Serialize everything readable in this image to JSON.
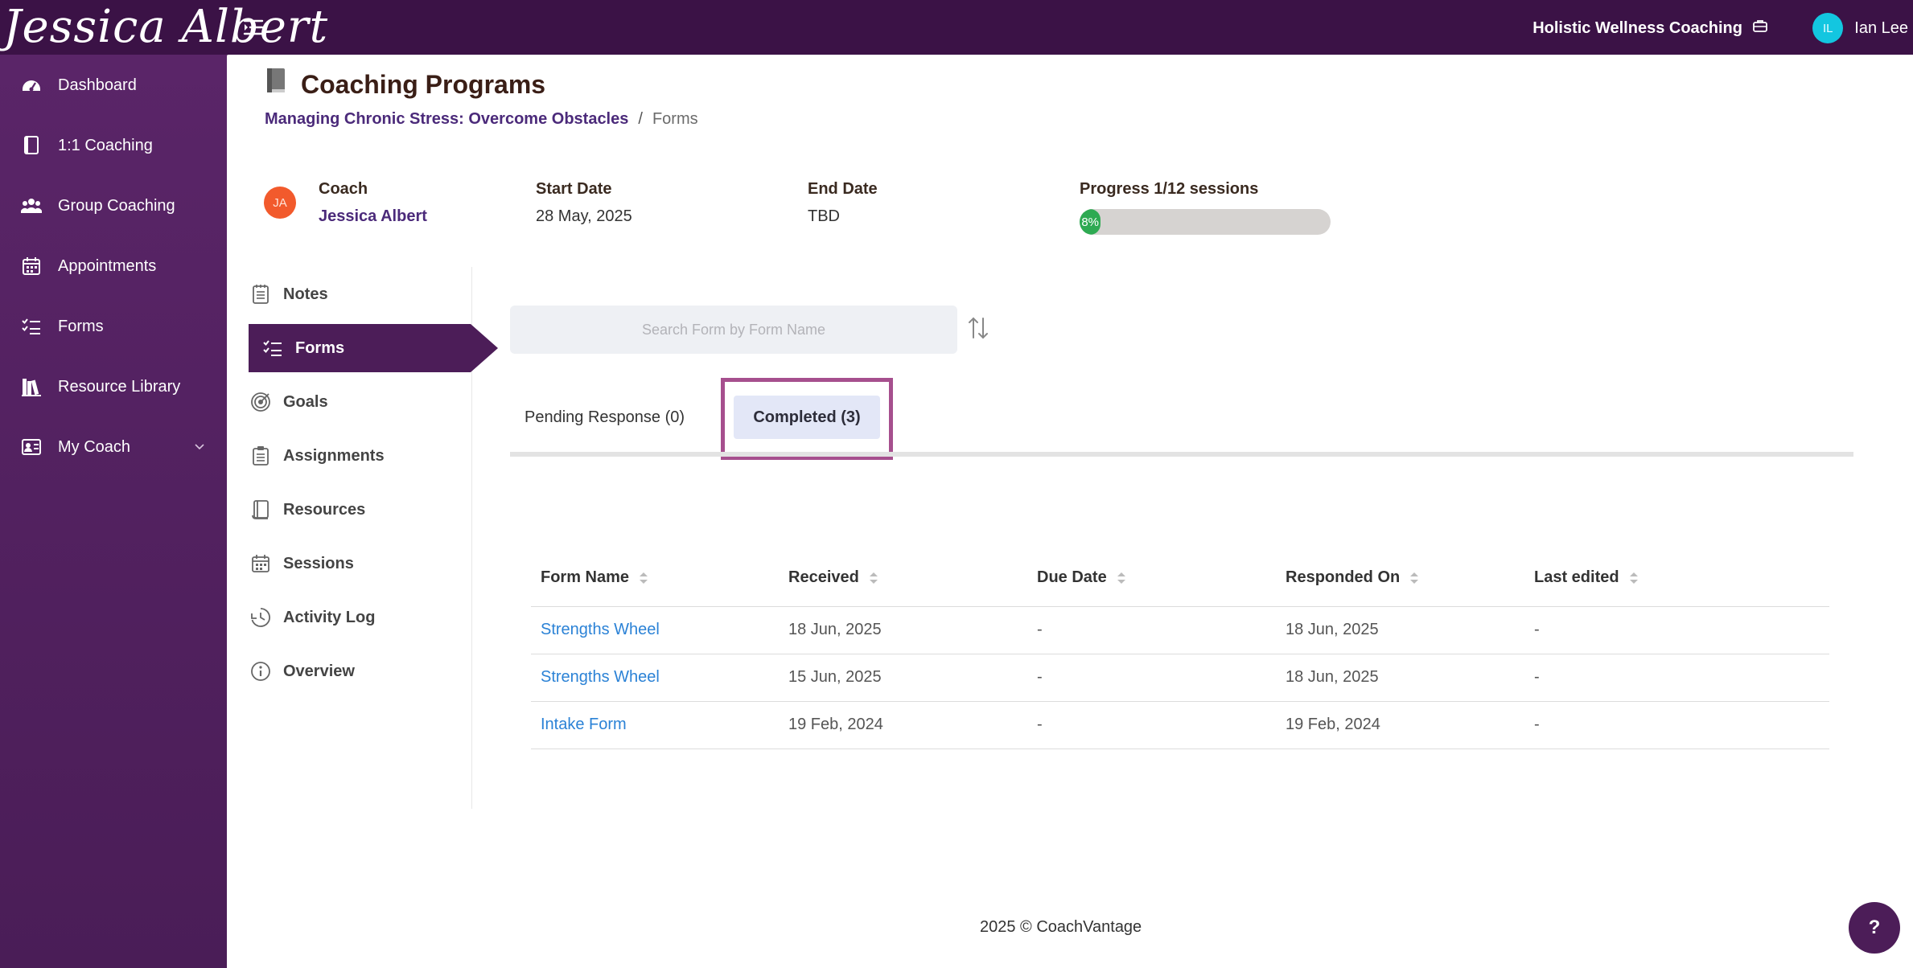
{
  "header": {
    "brand": "Jessica Albert",
    "organization": "Holistic Wellness Coaching",
    "user_initials": "IL",
    "user_name": "Ian Lee"
  },
  "sidebar": {
    "items": [
      {
        "label": "Dashboard",
        "icon": "dashboard-icon"
      },
      {
        "label": "1:1 Coaching",
        "icon": "book-icon"
      },
      {
        "label": "Group Coaching",
        "icon": "users-icon"
      },
      {
        "label": "Appointments",
        "icon": "calendar-icon"
      },
      {
        "label": "Forms",
        "icon": "checklist-icon"
      },
      {
        "label": "Resource Library",
        "icon": "library-icon"
      },
      {
        "label": "My Coach",
        "icon": "contact-card-icon"
      }
    ]
  },
  "page": {
    "title": "Coaching Programs",
    "breadcrumb": {
      "parent": "Managing Chronic Stress: Overcome Obstacles",
      "separator": "/",
      "current": "Forms"
    }
  },
  "program_info": {
    "coach_label": "Coach",
    "coach_initials": "JA",
    "coach_name": "Jessica Albert",
    "start_label": "Start Date",
    "start_value": "28 May, 2025",
    "end_label": "End Date",
    "end_value": "TBD",
    "progress_label": "Progress 1/12 sessions",
    "progress_percent_text": "8%",
    "progress_fraction": 0.08
  },
  "subnav": {
    "items": [
      {
        "label": "Notes",
        "icon": "notepad-icon"
      },
      {
        "label": "Forms",
        "icon": "checklist-icon"
      },
      {
        "label": "Goals",
        "icon": "target-icon"
      },
      {
        "label": "Assignments",
        "icon": "clipboard-icon"
      },
      {
        "label": "Resources",
        "icon": "book-icon"
      },
      {
        "label": "Sessions",
        "icon": "calendar-icon"
      },
      {
        "label": "Activity Log",
        "icon": "clock-icon"
      },
      {
        "label": "Overview",
        "icon": "info-icon"
      }
    ]
  },
  "forms_panel": {
    "search_placeholder": "Search Form by Form Name",
    "tabs": {
      "pending": "Pending Response (0)",
      "completed": "Completed (3)"
    },
    "columns": [
      "Form Name",
      "Received",
      "Due Date",
      "Responded On",
      "Last edited"
    ],
    "rows": [
      [
        "Strengths Wheel",
        "18 Jun, 2025",
        "-",
        "18 Jun, 2025",
        "-"
      ],
      [
        "Strengths Wheel",
        "15 Jun, 2025",
        "-",
        "18 Jun, 2025",
        "-"
      ],
      [
        "Intake Form",
        "19 Feb, 2024",
        "-",
        "19 Feb, 2024",
        "-"
      ]
    ]
  },
  "footer": {
    "text": "2025 © CoachVantage"
  },
  "help_label": "?",
  "colors": {
    "brand_purple": "#4c1d58",
    "topbar": "#3b1246",
    "progress_green": "#2eaa52",
    "link_blue": "#2b82d6",
    "highlight": "#a64f8e"
  }
}
